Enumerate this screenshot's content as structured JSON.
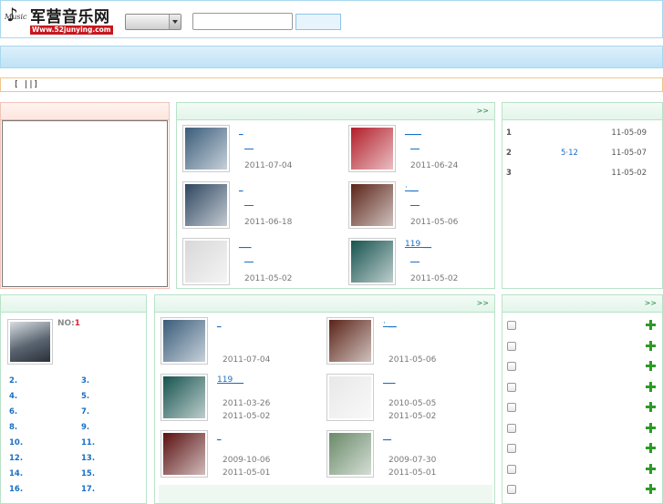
{
  "header": {
    "logo_text": "军营音乐网",
    "logo_url": "Www.52junying.com",
    "logo_music": "Music"
  },
  "notice": "[ ||]",
  "new_albums": {
    "more": ">>",
    "items": [
      {
        "title": "_",
        "date": "2011-07-04",
        "cover": "#3a5c7a"
      },
      {
        "title": "____",
        "date": "2011-06-24",
        "cover": "#b21e2a"
      },
      {
        "title": "_",
        "date": "2011-06-18",
        "cover": "#2e4660"
      },
      {
        "title": "· __",
        "date": "2011-05-06",
        "cover": "#5a2418"
      },
      {
        "title": "___",
        "date": "2011-05-02",
        "cover": "#d8d8d8"
      },
      {
        "title": "119 __",
        "date": "2011-05-02",
        "cover": "#17534f"
      }
    ]
  },
  "rank": {
    "rows": [
      {
        "num": "1",
        "mid": "",
        "date": "11-05-09"
      },
      {
        "num": "2",
        "mid": "5·12",
        "date": "11-05-07"
      },
      {
        "num": "3",
        "mid": "",
        "date": "11-05-02"
      }
    ]
  },
  "top_singer": {
    "no_label": "NO:",
    "no_value": "1",
    "list": [
      [
        "2.",
        "3."
      ],
      [
        "4.",
        "5."
      ],
      [
        "6.",
        "7."
      ],
      [
        "8.",
        "9."
      ],
      [
        "10.",
        "11."
      ],
      [
        "12.",
        "13."
      ],
      [
        "14.",
        "15."
      ],
      [
        "16.",
        "17."
      ]
    ]
  },
  "hot_albums": {
    "more": ">>",
    "items": [
      {
        "title": "_",
        "date1": "",
        "date2": "2011-07-04",
        "cover": "#3a5c7a"
      },
      {
        "title": "· __",
        "date1": "",
        "date2": "2011-05-06",
        "cover": "#5a2418"
      },
      {
        "title": "119 __",
        "date1": "2011-03-26",
        "date2": "2011-05-02",
        "cover": "#17534f"
      },
      {
        "title": "___",
        "date1": "2010-05-05",
        "date2": "2011-05-02",
        "cover": "#e8e8e8"
      },
      {
        "title": "_",
        "date1": "2009-10-06",
        "date2": "2011-05-01",
        "cover": "#5a1010"
      },
      {
        "title": "__",
        "date1": "2009-07-30",
        "date2": "2011-05-01",
        "cover": "#6a8a6a"
      }
    ]
  },
  "check_list": {
    "more": ">>",
    "count": 9
  }
}
